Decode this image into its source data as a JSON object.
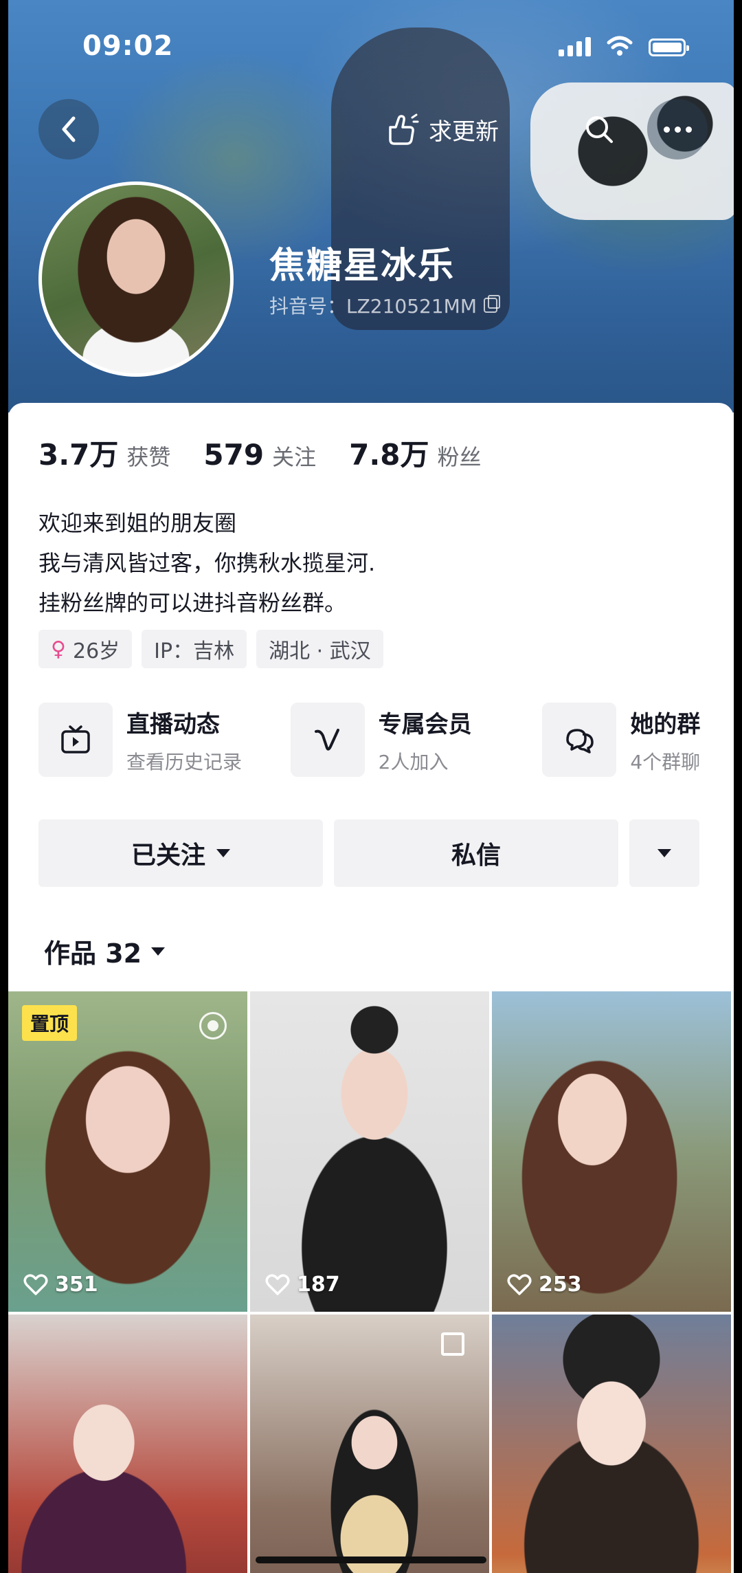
{
  "status_bar": {
    "time": "09:02"
  },
  "header": {
    "update_label": "求更新",
    "nickname": "焦糖星冰乐",
    "douyin_id": "抖音号：LZ210521MM"
  },
  "stats": [
    {
      "value": "3.7万",
      "label": "获赞"
    },
    {
      "value": "579",
      "label": "关注"
    },
    {
      "value": "7.8万",
      "label": "粉丝"
    }
  ],
  "bio": [
    "欢迎来到姐的朋友圈",
    "我与清风皆过客，你携秋水揽星河.",
    "挂粉丝牌的可以进抖音粉丝群。"
  ],
  "tags": {
    "gender_symbol": "♀",
    "age": "26岁",
    "ip": "IP：吉林",
    "location": "湖北 · 武汉"
  },
  "services": [
    {
      "title": "直播动态",
      "subtitle": "查看历史记录",
      "icon": "tv-icon"
    },
    {
      "title": "专属会员",
      "subtitle": "2人加入",
      "icon": "v-icon"
    },
    {
      "title": "她的群",
      "subtitle": "4个群聊",
      "icon": "chat-icon"
    }
  ],
  "actions": {
    "follow_label": "已关注",
    "message_label": "私信"
  },
  "works": {
    "label": "作品 32"
  },
  "videos": [
    {
      "likes": "351",
      "pinned_label": "置顶"
    },
    {
      "likes": "187"
    },
    {
      "likes": "253"
    },
    {
      "likes": ""
    },
    {
      "likes": ""
    },
    {
      "likes": ""
    }
  ]
}
